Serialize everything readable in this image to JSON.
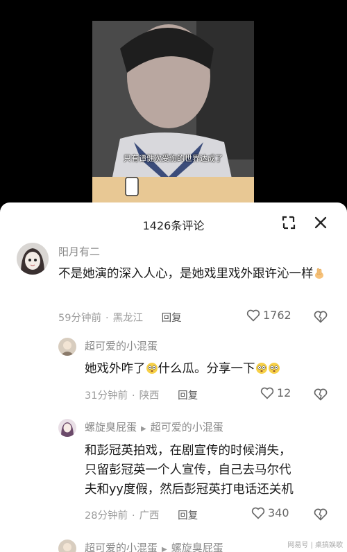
{
  "video": {
    "subtitle": "只有谭健次受伤的世界达成了"
  },
  "sheet": {
    "title": "1426条评论"
  },
  "comments": [
    {
      "username": "阳月有二",
      "text": "不是她演的深入人心，是她戏里戏外跟许沁一样",
      "time": "59分钟前",
      "location": "黑龙江",
      "reply_label": "回复",
      "likes": "1762"
    },
    {
      "username": "超可爱的小混蛋",
      "text_before": "她戏外咋了",
      "text_middle": "什么瓜。分享一下",
      "time": "31分钟前",
      "location": "陕西",
      "reply_label": "回复",
      "likes": "12"
    },
    {
      "username": "螺旋臭屁蛋",
      "reply_to": "超可爱的小混蛋",
      "text_line1": "和彭冠英拍戏，在剧宣传的时候消失，",
      "text_line2": "只留彭冠英一个人宣传，自己去马尔代",
      "text_line3": "夫和yy度假，然后彭冠英打电话还关机",
      "time": "28分钟前",
      "location": "广西",
      "reply_label": "回复",
      "likes": "340"
    },
    {
      "username": "超可爱的小混蛋",
      "reply_to": "螺旋臭屁蛋"
    }
  ],
  "watermark": "网易号 | 桌搞娱歌",
  "icons": {
    "expand": "expand-icon",
    "close": "close-icon",
    "like": "heart-icon",
    "dislike": "broken-heart-icon"
  }
}
